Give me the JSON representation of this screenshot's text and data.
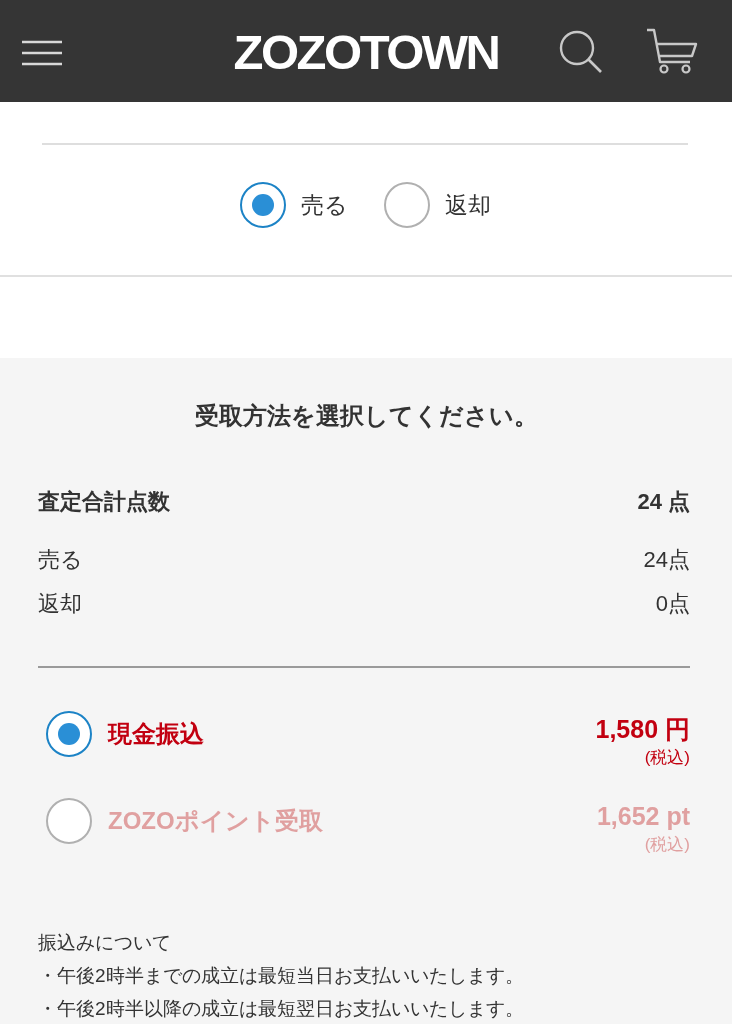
{
  "header": {
    "logo": "ZOZOTOWN"
  },
  "action_options": [
    {
      "label": "売る",
      "selected": true
    },
    {
      "label": "返却",
      "selected": false
    }
  ],
  "receipt": {
    "title": "受取方法を選択してください。",
    "summary": {
      "label": "査定合計点数",
      "value": "24 点"
    },
    "breakdown": [
      {
        "label": "売る",
        "value": "24点"
      },
      {
        "label": "返却",
        "value": "0点"
      }
    ],
    "methods": [
      {
        "label": "現金振込",
        "amount": "1,580 円",
        "tax_note": "(税込)",
        "selected": true
      },
      {
        "label": "ZOZOポイント受取",
        "amount": "1,652 pt",
        "tax_note": "(税込)",
        "selected": false
      }
    ],
    "notes": {
      "title": "振込みについて",
      "items": [
        "・午後2時半までの成立は最短当日お支払いいたします。",
        "・午後2時半以降の成立は最短翌日お支払いいたします。"
      ]
    }
  }
}
